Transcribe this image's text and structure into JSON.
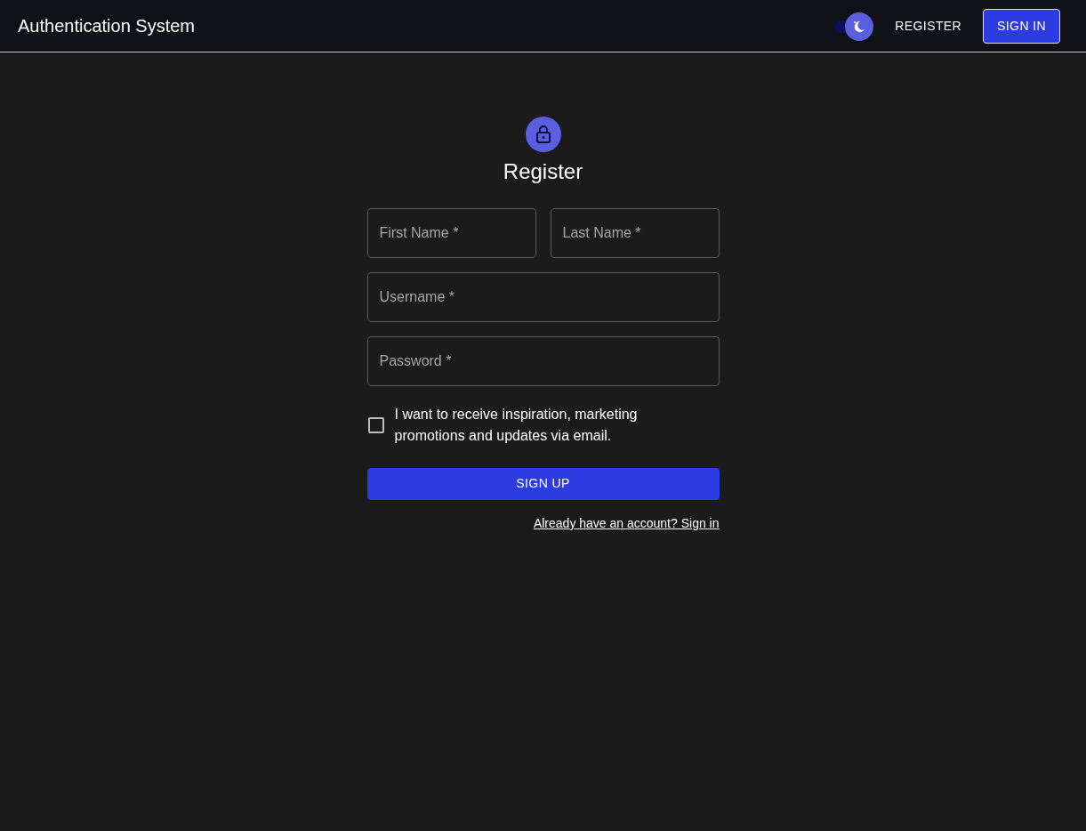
{
  "app_bar": {
    "title": "Authentication System",
    "theme_toggle": {
      "on": true
    },
    "links": [
      {
        "label": "REGISTER",
        "kind": "text"
      },
      {
        "label": "SIGN IN",
        "kind": "outlined"
      }
    ]
  },
  "form": {
    "title": "Register",
    "name_fields": [
      {
        "placeholder": "First Name *"
      },
      {
        "placeholder": "Last Name *"
      }
    ],
    "fields": [
      {
        "placeholder": "Username *"
      },
      {
        "placeholder": "Password *"
      }
    ],
    "consent": {
      "label": "I want to receive inspiration, marketing promotions and updates via email.",
      "checked": false
    },
    "submit": "SIGN UP",
    "footer_link": "Already have an account? Sign in"
  }
}
